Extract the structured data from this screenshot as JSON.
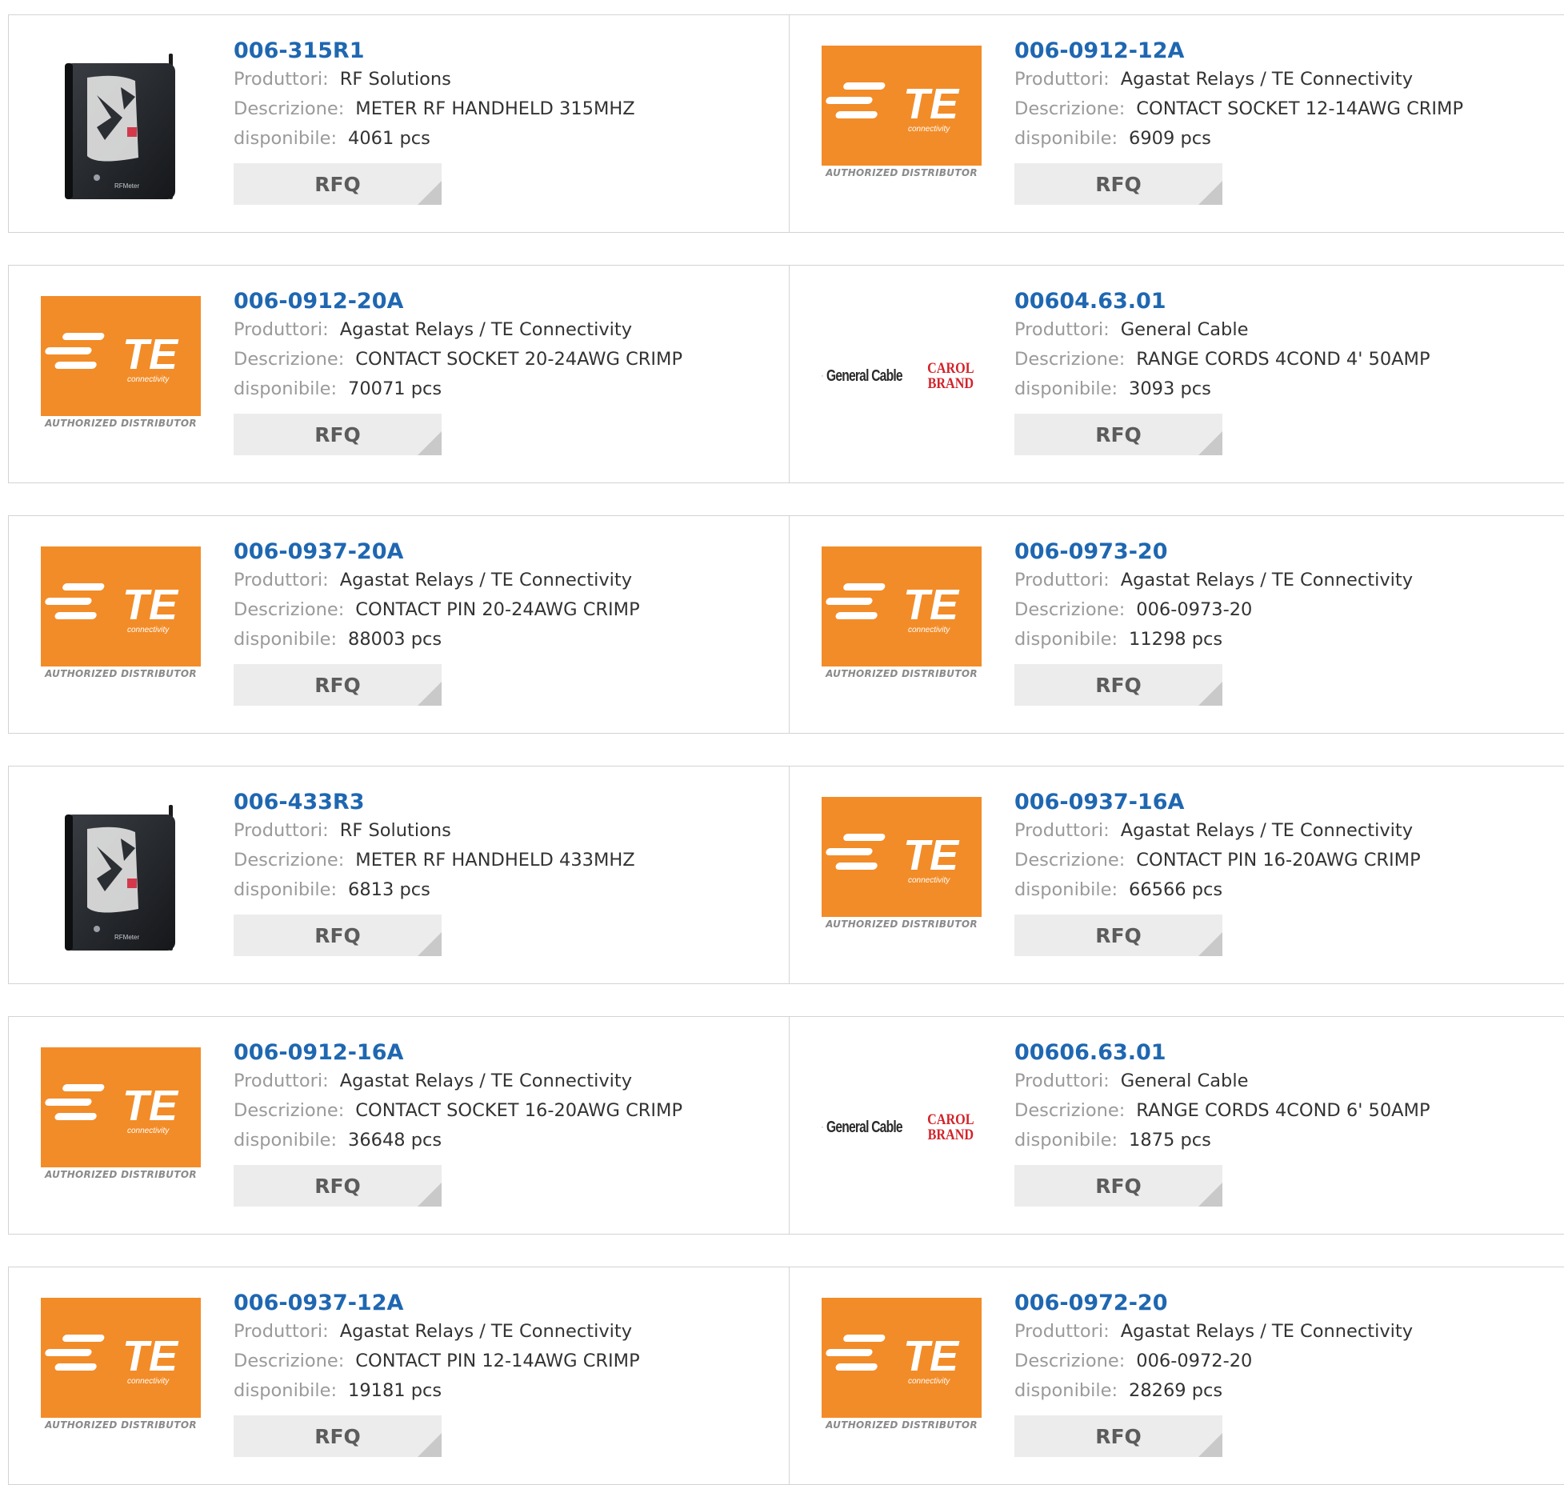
{
  "labels": {
    "manufacturer": "Produttori:",
    "description": "Descrizione:",
    "available": "disponibile:",
    "rfq": "RFQ"
  },
  "logo_texts": {
    "te_authorized": "AUTHORIZED DISTRIBUTOR",
    "te_sub": "connectivity",
    "gc_name": "General Cable",
    "gc_brand_line1": "CAROL",
    "gc_brand_line2": "BRAND"
  },
  "colors": {
    "link_blue": "#1f67b1",
    "te_orange": "#f28c28",
    "rfq_bg": "#ececec"
  },
  "products": [
    {
      "part": "006-315R1",
      "manufacturer": "RF Solutions",
      "description": "METER RF HANDHELD 315MHZ",
      "stock": "4061 pcs",
      "image": "rf-meter-photo"
    },
    {
      "part": "006-0912-12A",
      "manufacturer": "Agastat Relays / TE Connectivity",
      "description": "CONTACT SOCKET 12-14AWG CRIMP",
      "stock": "6909 pcs",
      "image": "te-logo"
    },
    {
      "part": "006-0912-20A",
      "manufacturer": "Agastat Relays / TE Connectivity",
      "description": "CONTACT SOCKET 20-24AWG CRIMP",
      "stock": "70071 pcs",
      "image": "te-logo"
    },
    {
      "part": "00604.63.01",
      "manufacturer": "General Cable",
      "description": "RANGE CORDS 4COND 4' 50AMP",
      "stock": "3093 pcs",
      "image": "general-cable-logo"
    },
    {
      "part": "006-0937-20A",
      "manufacturer": "Agastat Relays / TE Connectivity",
      "description": "CONTACT PIN 20-24AWG CRIMP",
      "stock": "88003 pcs",
      "image": "te-logo"
    },
    {
      "part": "006-0973-20",
      "manufacturer": "Agastat Relays / TE Connectivity",
      "description": "006-0973-20",
      "stock": "11298 pcs",
      "image": "te-logo"
    },
    {
      "part": "006-433R3",
      "manufacturer": "RF Solutions",
      "description": "METER RF HANDHELD 433MHZ",
      "stock": "6813 pcs",
      "image": "rf-meter-photo"
    },
    {
      "part": "006-0937-16A",
      "manufacturer": "Agastat Relays / TE Connectivity",
      "description": "CONTACT PIN 16-20AWG CRIMP",
      "stock": "66566 pcs",
      "image": "te-logo"
    },
    {
      "part": "006-0912-16A",
      "manufacturer": "Agastat Relays / TE Connectivity",
      "description": "CONTACT SOCKET 16-20AWG CRIMP",
      "stock": "36648 pcs",
      "image": "te-logo"
    },
    {
      "part": "00606.63.01",
      "manufacturer": "General Cable",
      "description": "RANGE CORDS 4COND 6' 50AMP",
      "stock": "1875 pcs",
      "image": "general-cable-logo"
    },
    {
      "part": "006-0937-12A",
      "manufacturer": "Agastat Relays / TE Connectivity",
      "description": "CONTACT PIN 12-14AWG CRIMP",
      "stock": "19181 pcs",
      "image": "te-logo"
    },
    {
      "part": "006-0972-20",
      "manufacturer": "Agastat Relays / TE Connectivity",
      "description": "006-0972-20",
      "stock": "28269 pcs",
      "image": "te-logo"
    }
  ]
}
